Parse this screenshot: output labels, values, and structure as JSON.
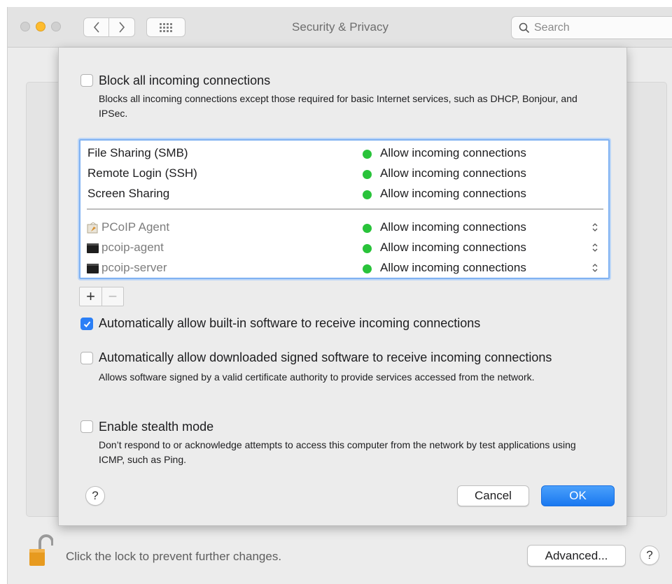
{
  "window": {
    "title": "Security & Privacy",
    "search_placeholder": "Search"
  },
  "sheet": {
    "block_all": {
      "label": "Block all incoming connections",
      "checked": false,
      "description": "Blocks all incoming connections except those required for basic Internet services, such as DHCP, Bonjour, and IPSec."
    },
    "services": [
      {
        "name": "File Sharing (SMB)",
        "status": "Allow incoming connections",
        "icon": "none"
      },
      {
        "name": "Remote Login (SSH)",
        "status": "Allow incoming connections",
        "icon": "none"
      },
      {
        "name": "Screen Sharing",
        "status": "Allow incoming connections",
        "icon": "none"
      }
    ],
    "apps": [
      {
        "name": "PCoIP Agent",
        "status": "Allow incoming connections",
        "icon": "app-installer-icon"
      },
      {
        "name": "pcoip-agent",
        "status": "Allow incoming connections",
        "icon": "terminal-exec-icon"
      },
      {
        "name": "pcoip-server",
        "status": "Allow incoming connections",
        "icon": "terminal-exec-icon"
      }
    ],
    "add_symbol": "+",
    "remove_symbol": "−",
    "auto_builtin": {
      "label": "Automatically allow built-in software to receive incoming connections",
      "checked": true
    },
    "auto_signed": {
      "label": "Automatically allow downloaded signed software to receive incoming connections",
      "checked": false,
      "description": "Allows software signed by a valid certificate authority to provide services accessed from the network."
    },
    "stealth": {
      "label": "Enable stealth mode",
      "checked": false,
      "description": "Don’t respond to or acknowledge attempts to access this computer from the network by test applications using ICMP, such as Ping."
    },
    "help_symbol": "?",
    "cancel_label": "Cancel",
    "ok_label": "OK"
  },
  "footer": {
    "lock_text": "Click the lock to prevent further changes.",
    "advanced_label": "Advanced...",
    "help_symbol": "?"
  },
  "colors": {
    "status_green": "#29c33a",
    "accent_blue": "#1a78f0",
    "traffic_yellow": "#febc2e"
  }
}
